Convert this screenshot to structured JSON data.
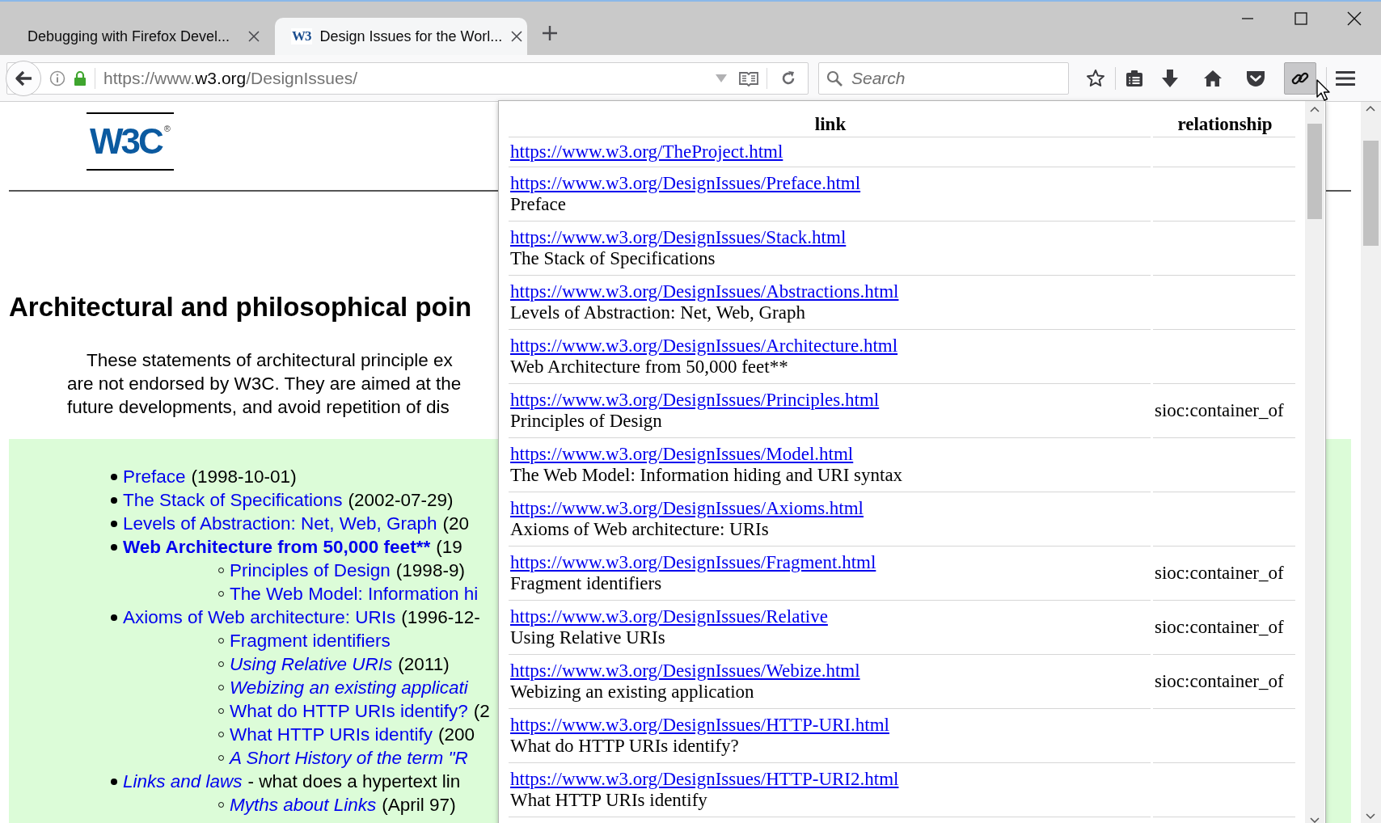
{
  "tabs": [
    {
      "title": "Debugging with Firefox Devel...",
      "selected": false
    },
    {
      "title": "Design Issues for the Worl...",
      "favicon": "W3",
      "selected": true
    }
  ],
  "address_bar": {
    "scheme": "https://www.",
    "domain": "w3.org",
    "path": "/DesignIssues/"
  },
  "search": {
    "placeholder": "Search"
  },
  "toolbar_buttons": [
    {
      "kind": "bookmark",
      "pressed": false
    },
    {
      "kind": "reading-list",
      "pressed": false
    },
    {
      "kind": "download",
      "pressed": false
    },
    {
      "kind": "home",
      "pressed": false
    },
    {
      "kind": "pocket",
      "pressed": false
    },
    {
      "kind": "links",
      "pressed": true
    },
    {
      "kind": "menu",
      "pressed": false
    }
  ],
  "page": {
    "logo": {
      "text": "W3C",
      "mark": "®"
    },
    "heading": "Architectural and philosophical poin",
    "intro": [
      "These statements of architectural principle ex",
      "are not endorsed by W3C. They are aimed at the",
      "future developments, and avoid repetition of dis"
    ],
    "contents": [
      {
        "link": "Preface",
        "kind": "normal",
        "note": "(1998-10-01)"
      },
      {
        "link": "The Stack of Specifications",
        "kind": "normal",
        "note": "(2002-07-29)"
      },
      {
        "link": "Levels of Abstraction: Net, Web, Graph",
        "kind": "normal",
        "note": "(20"
      },
      {
        "link": "Web Architecture from 50,000 feet**",
        "kind": "bold",
        "note": "(19",
        "children": [
          {
            "link": "Principles of Design",
            "kind": "normal",
            "note": "(1998-9)"
          },
          {
            "link": "The Web Model: Information hi",
            "kind": "normal"
          }
        ]
      },
      {
        "link": "Axioms of Web architecture: URIs",
        "kind": "normal",
        "note": "(1996-12-",
        "children": [
          {
            "link": "Fragment identifiers",
            "kind": "normal"
          },
          {
            "link": "Using Relative URIs",
            "kind": "italic",
            "note": "(2011)"
          },
          {
            "link": "Webizing an existing applicati",
            "kind": "italic"
          },
          {
            "link": "What do HTTP URIs identify?",
            "kind": "normal",
            "note": "(2"
          },
          {
            "link": "What HTTP URIs identify",
            "kind": "normal",
            "note": "(200"
          },
          {
            "link": "A Short History of the term \"R",
            "kind": "italic"
          }
        ]
      },
      {
        "link": "Links and laws",
        "kind": "italic",
        "note": "- what does a hypertext lin",
        "children": [
          {
            "link": "Myths about Links",
            "kind": "italic",
            "note": "(April 97)"
          }
        ]
      }
    ]
  },
  "links_popup": {
    "columns": [
      "link",
      "relationship"
    ],
    "rows": [
      {
        "url": "https://www.w3.org/TheProject.html"
      },
      {
        "url": "https://www.w3.org/DesignIssues/Preface.html",
        "title": "Preface"
      },
      {
        "url": "https://www.w3.org/DesignIssues/Stack.html",
        "title": "The Stack of Specifications"
      },
      {
        "url": "https://www.w3.org/DesignIssues/Abstractions.html",
        "title": "Levels of Abstraction: Net, Web, Graph"
      },
      {
        "url": "https://www.w3.org/DesignIssues/Architecture.html",
        "title": "Web Architecture from 50,000 feet**"
      },
      {
        "url": "https://www.w3.org/DesignIssues/Principles.html",
        "title": "Principles of Design",
        "relationship": "sioc:container_of"
      },
      {
        "url": "https://www.w3.org/DesignIssues/Model.html",
        "title": "The Web Model: Information hiding and URI syntax"
      },
      {
        "url": "https://www.w3.org/DesignIssues/Axioms.html",
        "title": "Axioms of Web architecture: URIs"
      },
      {
        "url": "https://www.w3.org/DesignIssues/Fragment.html",
        "title": "Fragment identifiers",
        "relationship": "sioc:container_of"
      },
      {
        "url": "https://www.w3.org/DesignIssues/Relative",
        "title": "Using Relative URIs",
        "relationship": "sioc:container_of"
      },
      {
        "url": "https://www.w3.org/DesignIssues/Webize.html",
        "title": "Webizing an existing application",
        "relationship": "sioc:container_of"
      },
      {
        "url": "https://www.w3.org/DesignIssues/HTTP-URI.html",
        "title": "What do HTTP URIs identify?"
      },
      {
        "url": "https://www.w3.org/DesignIssues/HTTP-URI2.html",
        "title": "What HTTP URIs identify"
      }
    ]
  }
}
